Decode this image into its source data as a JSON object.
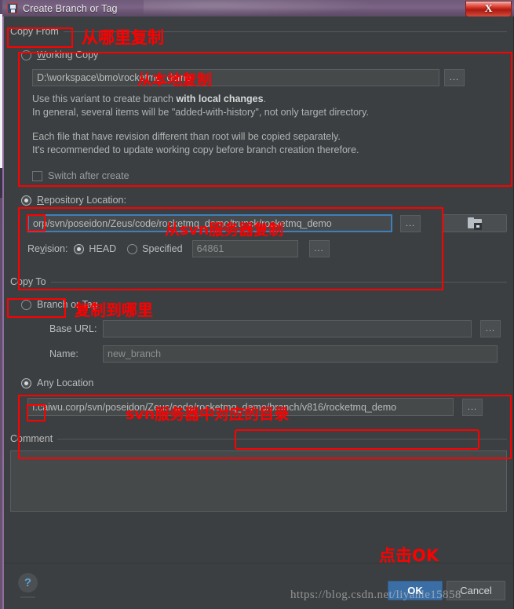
{
  "window": {
    "title": "Create Branch or Tag",
    "close_label": "X",
    "icon": "svn-branch-icon"
  },
  "copy_from": {
    "group_title": "Copy From",
    "working_copy": {
      "label": "Working Copy",
      "underline_char": "W",
      "selected": false,
      "path_value": "D:\\workspace\\bmo\\rocketmq_demo",
      "browse_label": "...",
      "help_lines": [
        "Use this variant to create branch with local changes.",
        "In general, several items will be \"added-with-history\", not only target directory.",
        "",
        "Each file that have revision different than root will be copied separately.",
        "It's recommended to update working copy before branch creation therefore."
      ],
      "help_line1_pre": "Use this variant to create branch ",
      "help_line1_bold": "with local changes",
      "help_line1_post": ".",
      "help_line2": "In general, several items will be \"added-with-history\", not only target directory.",
      "help_line3": "Each file that have revision different than root will be copied separately.",
      "help_line4": "It's recommended to update working copy before branch creation therefore."
    },
    "switch_after_create": {
      "label": "Switch after create",
      "checked": false
    },
    "repository_location": {
      "label": "Repository Location:",
      "underline_char": "R",
      "selected": true,
      "url_value": "orp/svn/poseidon/Zeus/code/rocketmq_demo/trunck/rocketmq_demo",
      "browse_label": "...",
      "folder_button_icon": "folder-browse-icon"
    },
    "revision": {
      "label": "Revision:",
      "underline_char": "v",
      "head_label": "HEAD",
      "head_selected": true,
      "specified_label": "Specified",
      "specified_selected": false,
      "specified_value": "64861",
      "browse_label": "..."
    }
  },
  "copy_to": {
    "group_title": "Copy To",
    "branch_or_tag": {
      "label": "Branch or Tag",
      "selected": false,
      "base_url_label": "Base URL:",
      "base_url_value": "",
      "base_url_browse": "...",
      "name_label": "Name:",
      "name_value": "new_branch"
    },
    "any_location": {
      "label": "Any Location",
      "selected": true,
      "url_value": "ı.caiwu.corp/svn/poseidon/Zeus/code/rocketmq_demo/branch/v816/rocketmq_demo",
      "browse_label": "..."
    }
  },
  "comment": {
    "group_title": "Comment",
    "underline_char": "C",
    "value": "",
    "placeholder": ""
  },
  "footer": {
    "help_label": "?",
    "ok_label": "OK",
    "cancel_label": "Cancel"
  },
  "annotations": {
    "copy_from_cn": "从哪里复制",
    "working_copy_cn": "从本地复制",
    "repository_cn": "从svn服务器复制",
    "copy_to_cn": "复制到哪里",
    "any_location_cn": "svn服务器中对应的目录",
    "click_ok_cn": "点击OK",
    "highlight_color": "#fe0000"
  },
  "watermark": {
    "text": "https://blog.csdn.net/liyanle15858"
  }
}
